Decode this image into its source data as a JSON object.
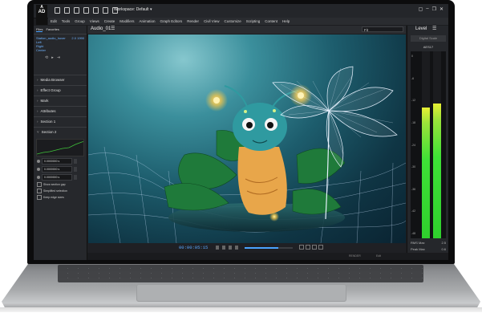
{
  "app": {
    "logo_line1": "A",
    "logo_line2": "AD",
    "workspace": "Workspace: Default"
  },
  "menu": [
    "Edit",
    "Tools",
    "Group",
    "Views",
    "Create",
    "Modifiers",
    "Animation",
    "Graph Editors",
    "Render",
    "Civil View",
    "Customize",
    "Scripting",
    "Content",
    "Help"
  ],
  "left_panel": {
    "tabs": [
      "Files",
      "Favorites"
    ],
    "tree": [
      {
        "name": "Station_audio_hover",
        "value": "2.0 1990"
      },
      {
        "name": "Left",
        "value": ""
      },
      {
        "name": "Right",
        "value": ""
      },
      {
        "name": "Center",
        "value": ""
      }
    ],
    "sections": [
      "Media Browser",
      "Effect Group",
      "Mark",
      "Attributes",
      "Section 1",
      "Section 2"
    ],
    "fields": [
      "0.0000000 s",
      "0.0000000 s",
      "0.0000000 s"
    ],
    "checks": [
      "Show section gap",
      "Simplified selection",
      "Keep edge sizes"
    ]
  },
  "viewport": {
    "title": "Audio_01",
    "fit": "Fit"
  },
  "transport": {
    "timecode": "00:00:05:15",
    "progress": 0.7
  },
  "status": {
    "left": "RENDER",
    "mid": "Edit"
  },
  "right_panel": {
    "title": "Level",
    "button": "Digital Scale",
    "meter_label": "AES17",
    "scale": [
      "0",
      "-6",
      "-12",
      "-18",
      "-24",
      "-30",
      "-36",
      "-42",
      "-48"
    ],
    "left_level": 0.7,
    "right_level": 0.72,
    "rms_label": "RMS Max",
    "rms_value": "2.5",
    "peak_label": "Peak Max",
    "peak_value": "0.6"
  },
  "colors": {
    "accent": "#4aa3ff",
    "meter_green": "#3ee036"
  }
}
